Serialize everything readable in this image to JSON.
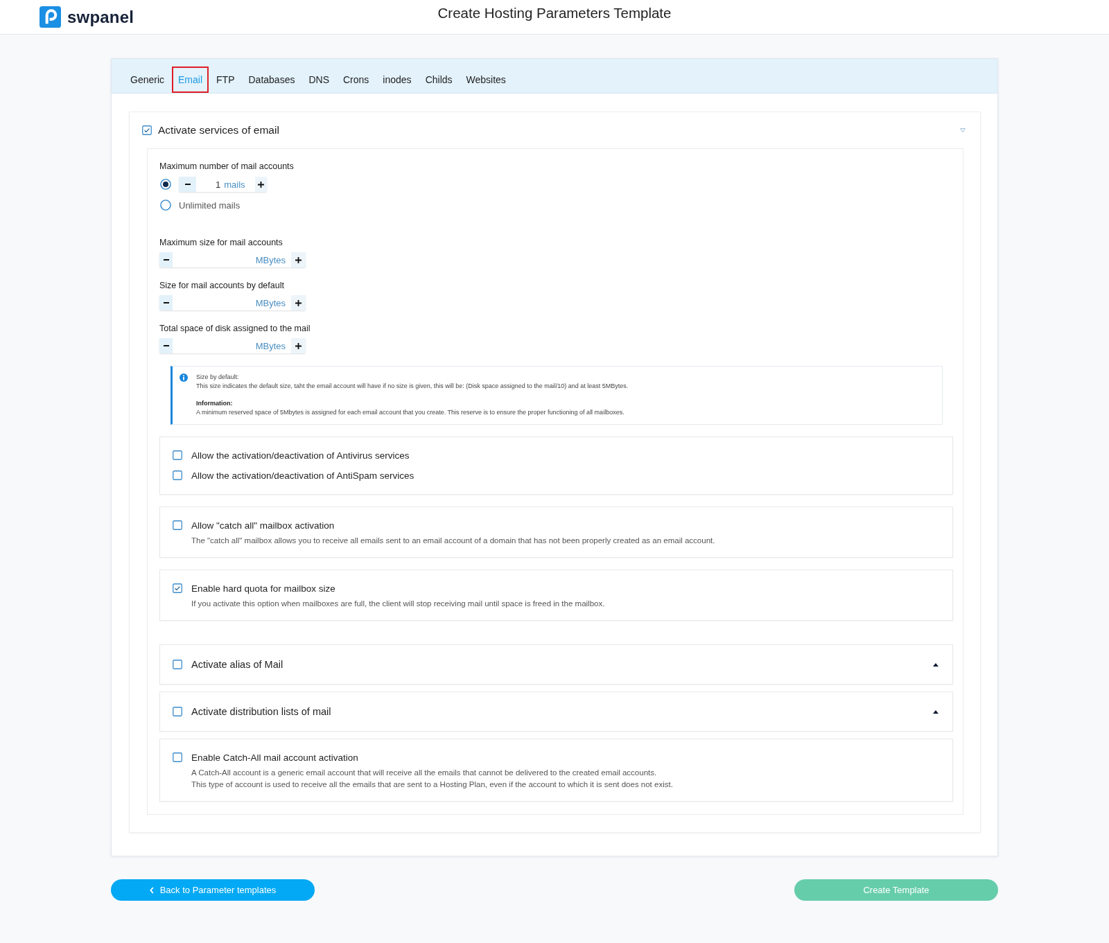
{
  "header": {
    "brand": "swpanel",
    "title": "Create Hosting Parameters Template"
  },
  "tabs": [
    {
      "label": "Generic",
      "selected": false
    },
    {
      "label": "Email",
      "selected": true
    },
    {
      "label": "FTP",
      "selected": false
    },
    {
      "label": "Databases",
      "selected": false
    },
    {
      "label": "DNS",
      "selected": false
    },
    {
      "label": "Crons",
      "selected": false
    },
    {
      "label": "inodes",
      "selected": false
    },
    {
      "label": "Childs",
      "selected": false
    },
    {
      "label": "Websites",
      "selected": false
    }
  ],
  "email_section": {
    "title": "Activate services of email",
    "checked": true,
    "mail_accounts": {
      "label": "Maximum number of mail accounts",
      "options": [
        {
          "kind": "stepper",
          "selected": true,
          "value": "1",
          "unit": "mails"
        },
        {
          "kind": "text",
          "selected": false,
          "label": "Unlimited mails"
        }
      ]
    },
    "size_fields": [
      {
        "label": "Maximum size for mail accounts",
        "unit": "MBytes"
      },
      {
        "label": "Size for mail accounts by default",
        "unit": "MBytes"
      },
      {
        "label": "Total space of disk assigned to the mail",
        "unit": "MBytes"
      }
    ],
    "info": [
      {
        "heading": "Size by default:",
        "bold": false,
        "text": "This size indicates the default size, taht the email account will have if no size is given, this will be: (Disk space assigned to the mail/10) and at least 5MBytes."
      },
      {
        "heading": "Information:",
        "bold": true,
        "text": "A minimum reserved space of 5Mbytes is assigned for each email account that you create. This reserve is to ensure the proper functioning of all mailboxes."
      }
    ],
    "option_cards": [
      {
        "kind": "checklist",
        "items": [
          {
            "label": "Allow the activation/deactivation of Antivirus services",
            "checked": false
          },
          {
            "label": "Allow the activation/deactivation of AntiSpam services",
            "checked": false
          }
        ]
      },
      {
        "kind": "described",
        "label": "Allow \"catch all\" mailbox activation",
        "checked": false,
        "description": [
          "The \"catch all\" mailbox allows you to receive all emails sent to an email account of a domain that has not been properly created as an email account."
        ]
      },
      {
        "kind": "described",
        "label": "Enable hard quota for mailbox size",
        "checked": true,
        "description": [
          "If you activate this option when mailboxes are full, the client will stop receiving mail until space is freed in the mailbox."
        ]
      },
      {
        "kind": "collapsible",
        "label": "Activate alias of Mail",
        "checked": false
      },
      {
        "kind": "collapsible",
        "label": "Activate distribution lists of mail",
        "checked": false
      },
      {
        "kind": "described",
        "label": "Enable Catch-All mail account activation",
        "checked": false,
        "description": [
          "A Catch-All account is a generic email account that will receive all the emails that cannot be delivered to the created email accounts.",
          "This type of account is used to receive all the emails that are sent to a Hosting Plan, even if the account to which it is sent does not exist."
        ]
      }
    ]
  },
  "buttons": {
    "back": "Back to Parameter templates",
    "create": "Create Template"
  }
}
